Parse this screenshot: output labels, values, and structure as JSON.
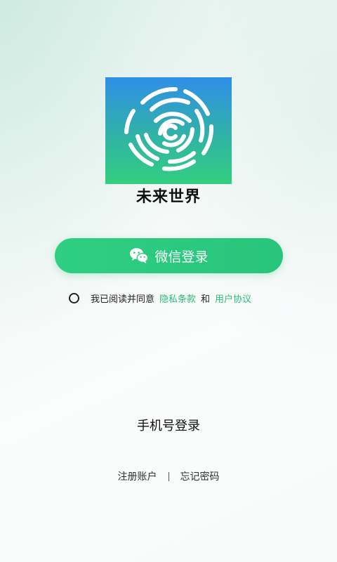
{
  "app": {
    "name": "未来世界",
    "logo_icon": "fingerprint-spiral-icon"
  },
  "login": {
    "wechat_label": "微信登录",
    "wechat_icon": "wechat-icon",
    "phone_login_label": "手机号登录"
  },
  "agreement": {
    "prefix": "我已阅读并同意",
    "privacy_label": "隐私条款",
    "and": "和",
    "user_agreement_label": "用户协议",
    "checked": false
  },
  "footer": {
    "register_label": "注册账户",
    "divider": "|",
    "forgot_password_label": "忘记密码"
  },
  "colors": {
    "accent_green": "#2abf7a",
    "button_green": "#2fcf83",
    "logo_gradient_top": "#2f8ee8",
    "logo_gradient_bottom": "#33cf80"
  }
}
